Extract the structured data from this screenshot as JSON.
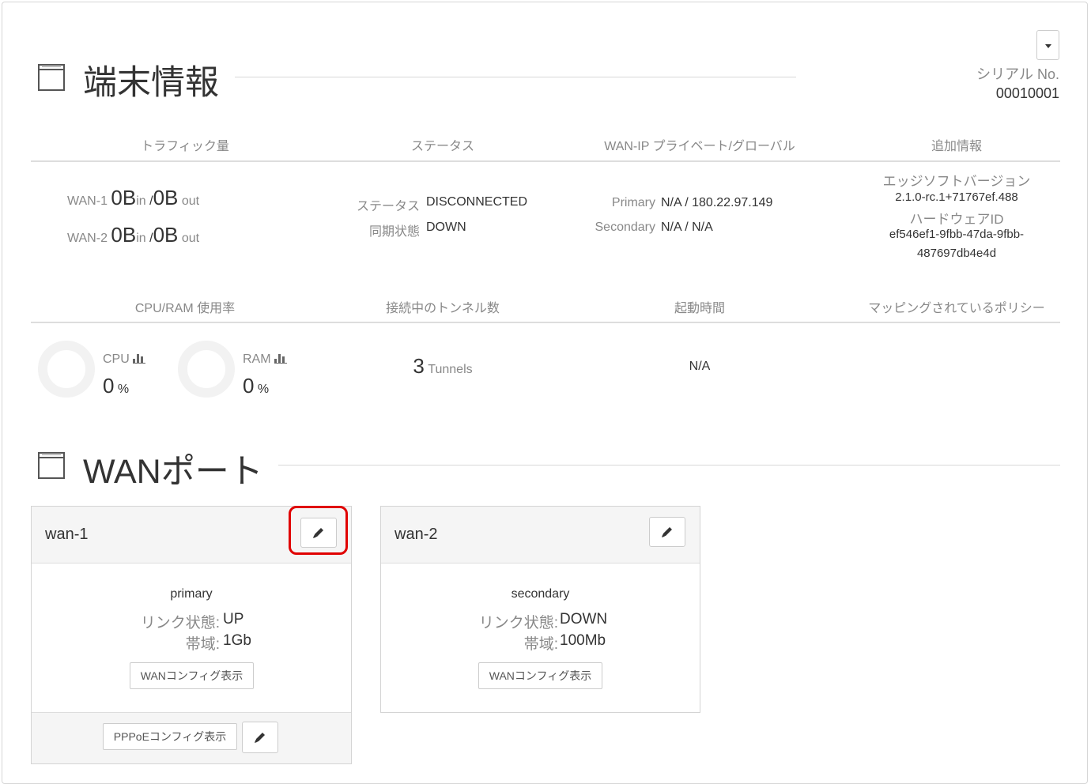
{
  "device_info": {
    "title": "端末情報",
    "serial_label": "シリアル No.",
    "serial_value": "00010001"
  },
  "columns_top": [
    "トラフィック量",
    "ステータス",
    "WAN-IP プライベート/グローバル",
    "追加情報"
  ],
  "traffic": [
    {
      "label": "WAN-1",
      "in_value": "0B",
      "in_unit": "in",
      "sep": "/",
      "out_value": "0B",
      "out_unit": "out"
    },
    {
      "label": "WAN-2",
      "in_value": "0B",
      "in_unit": "in",
      "sep": "/",
      "out_value": "0B",
      "out_unit": "out"
    }
  ],
  "status": {
    "status_label": "ステータス",
    "status_value": "DISCONNECTED",
    "sync_label": "同期状態",
    "sync_value": "DOWN"
  },
  "wan_ip": {
    "primary_label": "Primary",
    "primary_value": "N/A / 180.22.97.149",
    "secondary_label": "Secondary",
    "secondary_value": "N/A / N/A"
  },
  "extra_info": {
    "edge_label": "エッジソフトバージョン",
    "edge_value": "2.1.0-rc.1+71767ef.488",
    "hw_label": "ハードウェアID",
    "hw_value_1": "ef546ef1-9fbb-47da-9fbb-",
    "hw_value_2": "487697db4e4d"
  },
  "columns_bottom": [
    "CPU/RAM 使用率",
    "接続中のトンネル数",
    "起動時間",
    "マッピングされているポリシー"
  ],
  "usage": {
    "cpu_label": "CPU",
    "cpu_value": "0",
    "cpu_unit": "%",
    "ram_label": "RAM",
    "ram_value": "0",
    "ram_unit": "%"
  },
  "tunnels": {
    "count": "3",
    "unit": "Tunnels"
  },
  "uptime": "N/A",
  "wan_ports": {
    "title": "WANポート",
    "cards": [
      {
        "name": "wan-1",
        "role": "primary",
        "link_label": "リンク状態:",
        "link_value": "UP",
        "bw_label": "帯域:",
        "bw_value": "1Gb",
        "config_button": "WANコンフィグ表示",
        "pppoe_button": "PPPoEコンフィグ表示"
      },
      {
        "name": "wan-2",
        "role": "secondary",
        "link_label": "リンク状態:",
        "link_value": "DOWN",
        "bw_label": "帯域:",
        "bw_value": "100Mb",
        "config_button": "WANコンフィグ表示"
      }
    ]
  }
}
